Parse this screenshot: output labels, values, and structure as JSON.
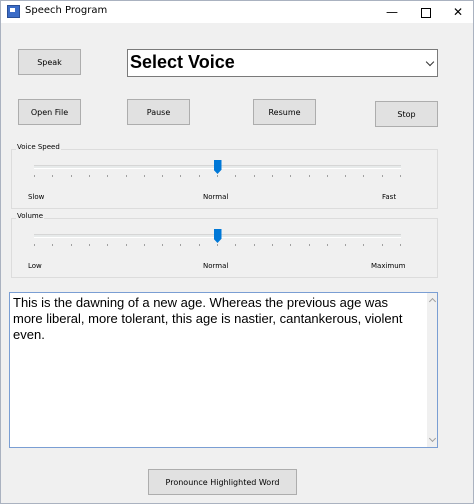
{
  "window": {
    "title": "Speech Program"
  },
  "controls": {
    "speak": "Speak",
    "open_file": "Open File",
    "pause": "Pause",
    "resume": "Resume",
    "stop": "Stop",
    "pronounce": "Pronounce Highlighted Word"
  },
  "voice_select": {
    "value": "Select Voice"
  },
  "voice_speed": {
    "label": "Voice Speed",
    "min_label": "Slow",
    "mid_label": "Normal",
    "max_label": "Fast",
    "level": 0.5,
    "ticks": 21
  },
  "volume": {
    "label": "Volume",
    "min_label": "Low",
    "mid_label": "Normal",
    "max_label": "Maximum",
    "level": 0.5,
    "ticks": 21
  },
  "text_area": {
    "content": "This is the dawning of a new age. Whereas the previous age was more liberal, more tolerant, this age is nastier, cantankerous, violent even."
  },
  "icons": {
    "app": "app-icon",
    "minimize": "minimize-icon",
    "maximize": "maximize-icon",
    "close": "close-icon",
    "dropdown": "chevron-down-icon"
  }
}
